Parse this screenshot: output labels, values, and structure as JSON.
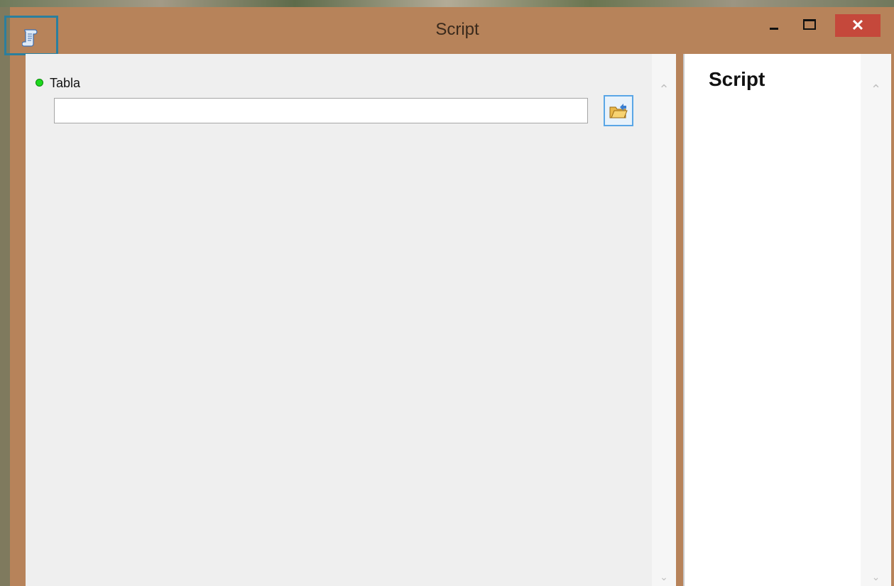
{
  "window": {
    "title": "Script",
    "close_label": "✕"
  },
  "parameters": {
    "table": {
      "label": "Tabla",
      "value": "",
      "placeholder": ""
    }
  },
  "help": {
    "title": "Script"
  },
  "colors": {
    "titlebar": "#b7835a",
    "close_button": "#c5483b",
    "required_dot": "#1ed81e",
    "panel_bg": "#efefef"
  },
  "icons": {
    "app": "script-scroll-icon",
    "browse": "open-folder-icon",
    "minimize": "minimize-icon",
    "maximize": "maximize-icon",
    "close": "close-icon"
  }
}
